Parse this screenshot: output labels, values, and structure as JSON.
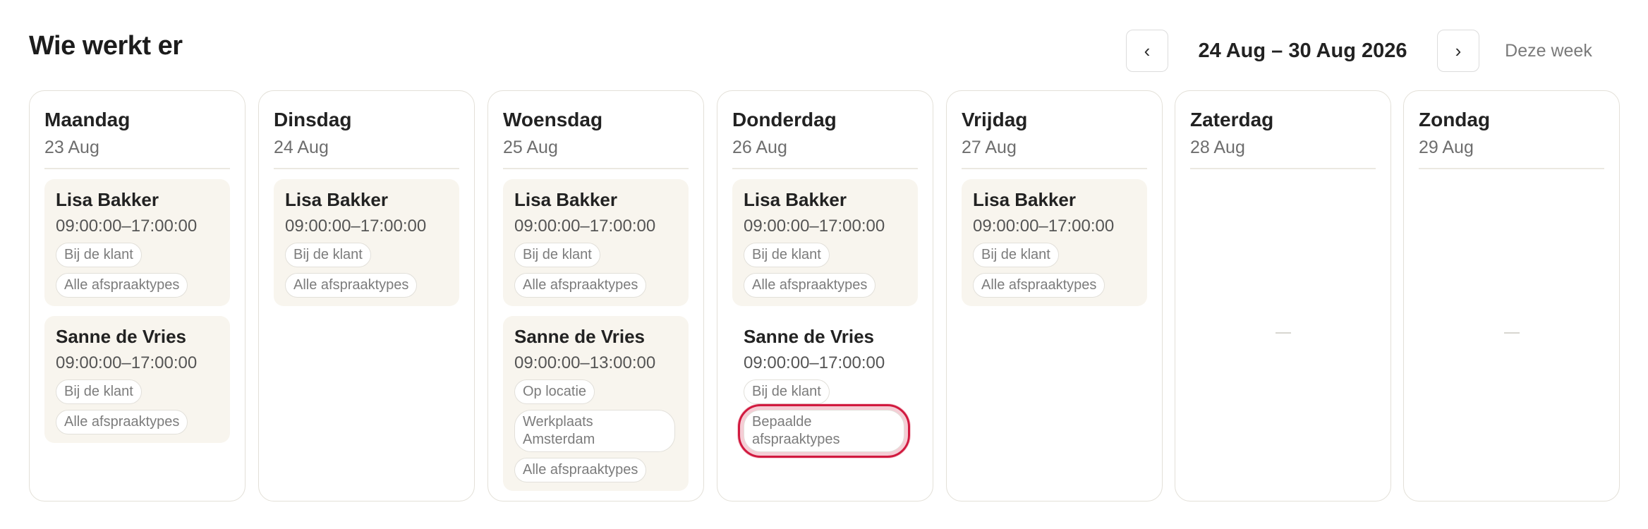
{
  "header": {
    "title": "Wie werkt er",
    "prev_icon": "‹",
    "next_icon": "›",
    "week_range": "24 Aug – 30 Aug 2026",
    "this_week_label": "Deze week"
  },
  "days": [
    {
      "name": "Maandag",
      "date": "23 Aug",
      "shifts": [
        {
          "person": "Lisa Bakker",
          "time": "09:00:00–17:00:00",
          "tags": [
            "Bij de klant",
            "Alle afspraaktypes"
          ]
        },
        {
          "person": "Sanne de Vries",
          "time": "09:00:00–17:00:00",
          "tags": [
            "Bij de klant",
            "Alle afspraaktypes"
          ]
        }
      ]
    },
    {
      "name": "Dinsdag",
      "date": "24 Aug",
      "shifts": [
        {
          "person": "Lisa Bakker",
          "time": "09:00:00–17:00:00",
          "tags": [
            "Bij de klant",
            "Alle afspraaktypes"
          ]
        }
      ]
    },
    {
      "name": "Woensdag",
      "date": "25 Aug",
      "shifts": [
        {
          "person": "Lisa Bakker",
          "time": "09:00:00–17:00:00",
          "tags": [
            "Bij de klant",
            "Alle afspraaktypes"
          ]
        },
        {
          "person": "Sanne de Vries",
          "time": "09:00:00–13:00:00",
          "tags": [
            "Op locatie",
            "Werkplaats Amsterdam",
            "Alle afspraaktypes"
          ]
        }
      ]
    },
    {
      "name": "Donderdag",
      "date": "26 Aug",
      "shifts": [
        {
          "person": "Lisa Bakker",
          "time": "09:00:00–17:00:00",
          "tags": [
            "Bij de klant",
            "Alle afspraaktypes"
          ]
        },
        {
          "person": "Sanne de Vries",
          "time": "09:00:00–17:00:00",
          "tags": [
            "Bij de klant",
            "Bepaalde afspraaktypes"
          ]
        }
      ]
    },
    {
      "name": "Vrijdag",
      "date": "27 Aug",
      "shifts": [
        {
          "person": "Lisa Bakker",
          "time": "09:00:00–17:00:00",
          "tags": [
            "Bij de klant",
            "Alle afspraaktypes"
          ]
        }
      ]
    },
    {
      "name": "Zaterdag",
      "date": "28 Aug",
      "shifts": []
    },
    {
      "name": "Zondag",
      "date": "29 Aug",
      "shifts": []
    }
  ],
  "colors": {
    "card_bg": "#f8f5ee",
    "focus_ring": "#d11a3f"
  }
}
